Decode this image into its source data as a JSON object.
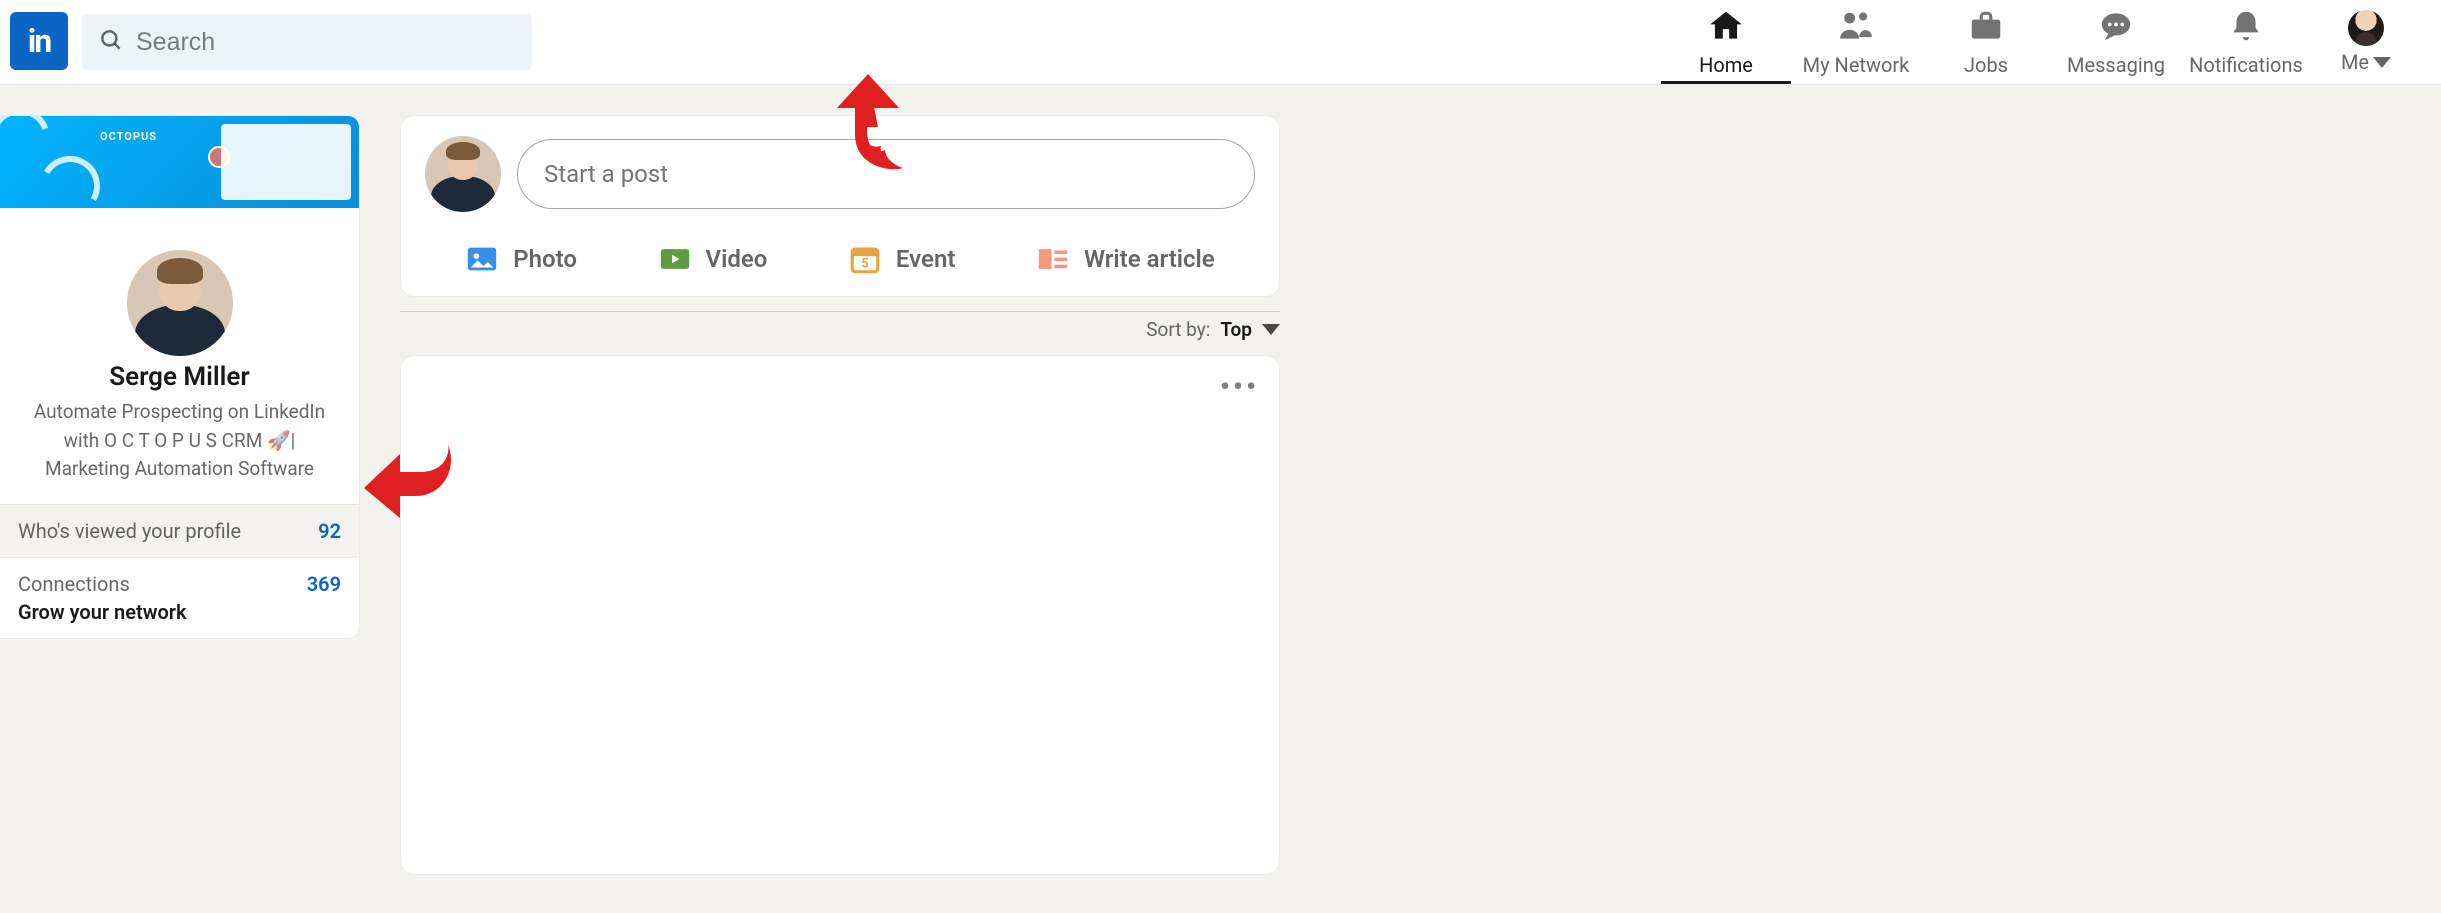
{
  "brand": "in",
  "search": {
    "placeholder": "Search"
  },
  "nav": {
    "home": "Home",
    "network": "My Network",
    "jobs": "Jobs",
    "messaging": "Messaging",
    "notifications": "Notifications",
    "me": "Me"
  },
  "profile": {
    "cover_brand": "OCTOPUS",
    "name": "Serge Miller",
    "headline": "Automate Prospecting on LinkedIn with O C T O P U S CRM 🚀| Marketing Automation Software"
  },
  "stats": {
    "viewed_label": "Who's viewed your profile",
    "viewed_count": "92",
    "connections_label": "Connections",
    "connections_count": "369",
    "grow_label": "Grow your network"
  },
  "post": {
    "placeholder": "Start a post",
    "actions": {
      "photo": "Photo",
      "video": "Video",
      "event": "Event",
      "article": "Write article"
    }
  },
  "sort": {
    "prefix": "Sort by:",
    "value": "Top"
  },
  "feed": {
    "menu": "•••"
  }
}
